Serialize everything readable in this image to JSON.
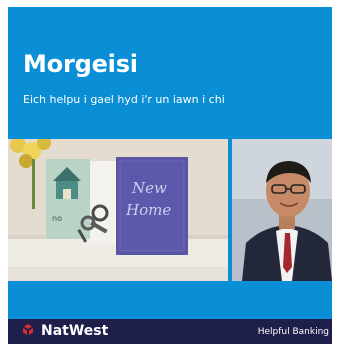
{
  "header": {
    "title": "Morgeisi",
    "subtitle": "Eich helpu i gael hyd i'r un iawn i chi"
  },
  "photos": {
    "left_card_text": "New Home"
  },
  "footer": {
    "brand_name": "NatWest",
    "tagline": "Helpful Banking",
    "logo_icon": "natwest-logo-icon"
  },
  "colors": {
    "panel_blue": "#0a8fd6",
    "footer_navy": "#1e1f4b",
    "logo_red": "#d72c2c"
  }
}
